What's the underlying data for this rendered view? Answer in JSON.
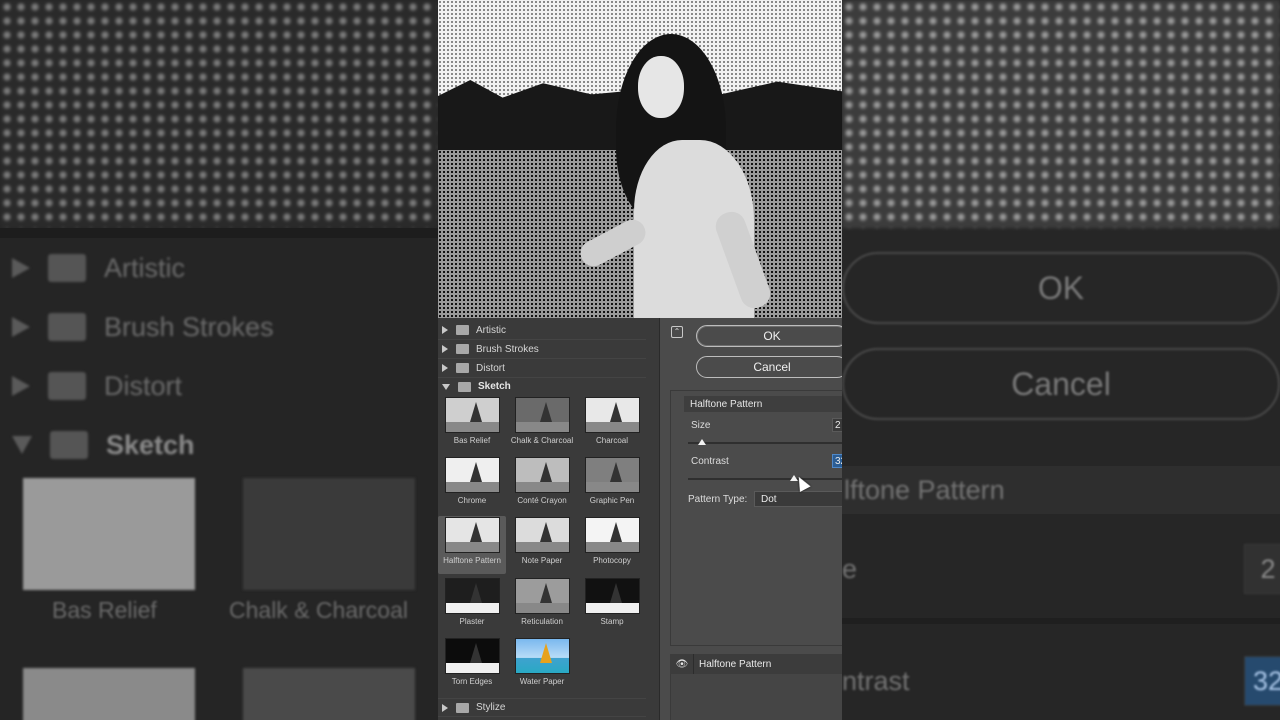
{
  "background_zoom": {
    "left_categories": [
      "Artistic",
      "Brush Strokes",
      "Distort",
      "Sketch"
    ],
    "left_thumbs": [
      "Bas Relief",
      "Chalk & Charcoal"
    ],
    "right_buttons": [
      "OK",
      "Cancel"
    ],
    "right_filter_name": "lftone Pattern",
    "right_size_label": "e",
    "right_size_value": "2",
    "right_contrast_label": "ntrast",
    "right_contrast_value": "32"
  },
  "categories": {
    "artistic": "Artistic",
    "brush_strokes": "Brush Strokes",
    "distort": "Distort",
    "sketch": "Sketch",
    "stylize": "Stylize"
  },
  "sketch_filters": [
    "Bas Relief",
    "Chalk & Charcoal",
    "Charcoal",
    "Chrome",
    "Conté Crayon",
    "Graphic Pen",
    "Halftone Pattern",
    "Note Paper",
    "Photocopy",
    "Plaster",
    "Reticulation",
    "Stamp",
    "Torn Edges",
    "Water Paper"
  ],
  "selected_filter": "Halftone Pattern",
  "buttons": {
    "ok": "OK",
    "cancel": "Cancel"
  },
  "settings": {
    "filter_name": "Halftone Pattern",
    "size_label": "Size",
    "size_value": "2",
    "size_fraction": 0.09,
    "contrast_label": "Contrast",
    "contrast_value": "32",
    "contrast_fraction": 0.66,
    "pattern_type_label": "Pattern Type:",
    "pattern_type_value": "Dot"
  },
  "layer": {
    "name": "Halftone Pattern",
    "visible_icon": "eye-icon"
  },
  "colors": {
    "selection_highlight": "#2b5d94",
    "panel": "#4b4b4b"
  }
}
